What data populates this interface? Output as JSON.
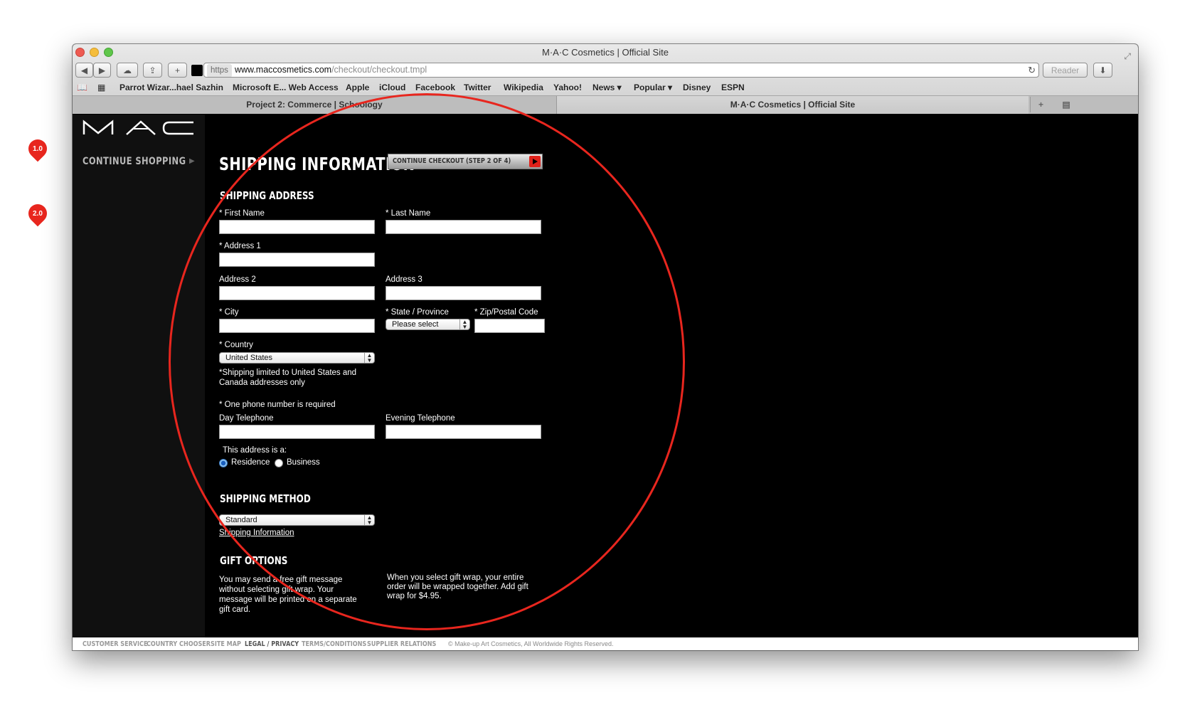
{
  "annotations": {
    "pin1": "1.0",
    "pin2": "2.0"
  },
  "window": {
    "title": "M·A·C Cosmetics | Official Site",
    "url_https": "https",
    "url_host": "www.maccosmetics.com",
    "url_path": "/checkout/checkout.tmpl",
    "reader_label": "Reader"
  },
  "bookmarks": [
    "Parrot Wizar...hael Sazhin",
    "Microsoft E... Web Access",
    "Apple",
    "iCloud",
    "Facebook",
    "Twitter",
    "Wikipedia",
    "Yahoo!",
    "News ▾",
    "Popular ▾",
    "Disney",
    "ESPN"
  ],
  "tabs": [
    "Project 2: Commerce | Schoology",
    "M·A·C Cosmetics | Official Site"
  ],
  "sidebar": {
    "continue_shopping": "CONTINUE SHOPPING"
  },
  "page": {
    "title": "SHIPPING INFORMATION",
    "checkout_button": "CONTINUE CHECKOUT (STEP 2 OF 4)",
    "shipping_address_heading": "SHIPPING ADDRESS",
    "labels": {
      "first_name": "* First Name",
      "last_name": "* Last Name",
      "address1": "* Address 1",
      "address2": "Address 2",
      "address3": "Address 3",
      "city": "* City",
      "state": "* State / Province",
      "zip": "* Zip/Postal Code",
      "country": "* Country",
      "phone_required": "* One phone number is required",
      "day_phone": "Day Telephone",
      "evening_phone": "Evening Telephone",
      "address_type": "This address is a:",
      "residence": "Residence",
      "business": "Business"
    },
    "state_value": "Please select",
    "country_value": "United States",
    "shipping_note": "*Shipping limited to United States and Canada addresses only",
    "shipping_method_heading": "SHIPPING METHOD",
    "shipping_method_value": "Standard",
    "shipping_info_link": "Shipping Information",
    "gift_heading": "GIFT OPTIONS",
    "gift_text_left": "You may send a free gift message without selecting gift wrap. Your message will be printed on a separate gift card.",
    "gift_text_right": "When you select gift wrap, your entire order will be wrapped together. Add gift wrap for $4.95."
  },
  "footer": {
    "items": [
      "CUSTOMER SERVICE",
      "COUNTRY CHOOSER",
      "SITE MAP",
      "LEGAL / PRIVACY",
      "TERMS/CONDITIONS",
      "SUPPLIER RELATIONS"
    ],
    "copyright": "© Make-up Art Cosmetics, All Worldwide Rights Reserved."
  },
  "colors": {
    "annotation_red": "#e8261e",
    "page_bg": "#000000",
    "sidebar_bg": "#101010"
  }
}
